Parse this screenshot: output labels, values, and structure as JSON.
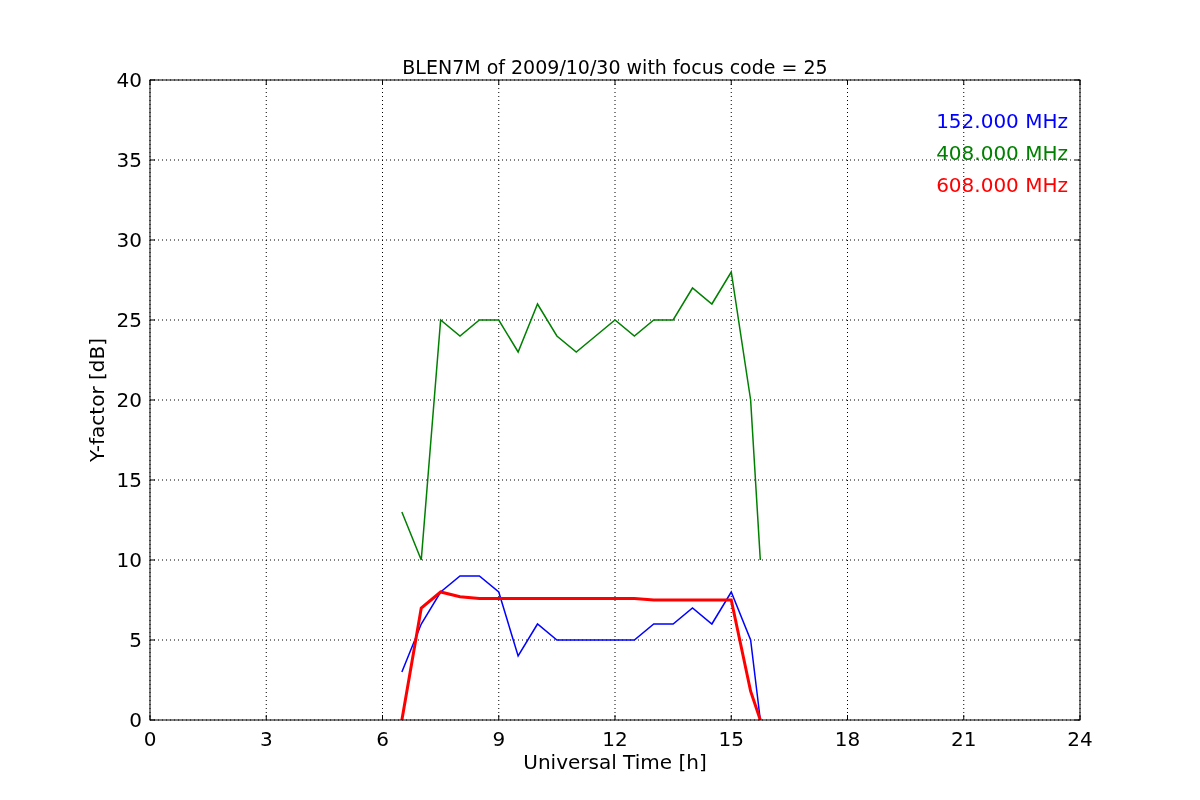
{
  "chart_data": {
    "type": "line",
    "title": "BLEN7M of 2009/10/30 with focus code = 25",
    "xlabel": "Universal Time [h]",
    "ylabel": "Y-factor [dB]",
    "x": [
      6.5,
      7,
      7.5,
      8,
      8.5,
      9,
      9.5,
      10,
      10.5,
      11,
      11.5,
      12,
      12.5,
      13,
      13.5,
      14,
      14.5,
      15,
      15.5,
      15.75
    ],
    "series": [
      {
        "name": "152.000 MHz",
        "color": "#0000ff",
        "values": [
          3,
          6,
          8,
          9,
          9,
          8,
          4,
          6,
          5,
          5,
          5,
          5,
          5,
          6,
          6,
          7,
          6,
          8,
          5,
          0
        ]
      },
      {
        "name": "408.000 MHz",
        "color": "#008000",
        "values": [
          13,
          10,
          25,
          24,
          25,
          25,
          23,
          26,
          24,
          23,
          24,
          25,
          24,
          25,
          25,
          27,
          26,
          28,
          20,
          10
        ]
      },
      {
        "name": "608.000 MHz",
        "color": "#ff0000",
        "values": [
          0,
          7,
          8,
          7.7,
          7.6,
          7.6,
          7.6,
          7.6,
          7.6,
          7.6,
          7.6,
          7.6,
          7.6,
          7.5,
          7.5,
          7.5,
          7.5,
          7.5,
          1.8,
          0
        ]
      }
    ],
    "grid": true,
    "xlim": [
      0,
      24
    ],
    "ylim": [
      0,
      40
    ],
    "xticks": [
      0,
      3,
      6,
      9,
      12,
      15,
      18,
      21,
      24
    ],
    "yticks": [
      0,
      5,
      10,
      15,
      20,
      25,
      30,
      35,
      40
    ]
  }
}
